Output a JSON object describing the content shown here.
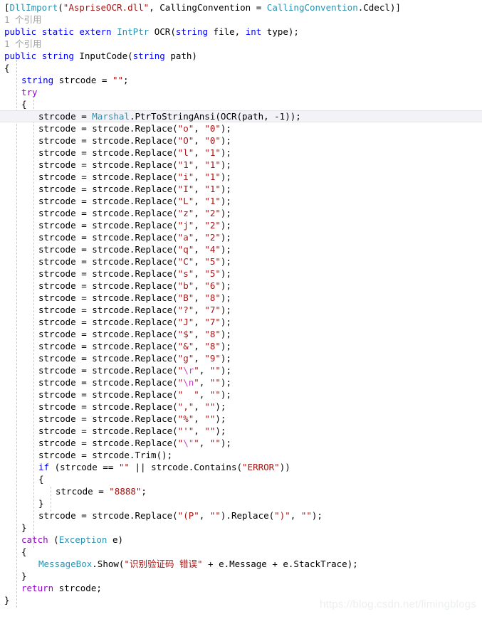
{
  "editor": {
    "language": "csharp",
    "current_line_index": 9,
    "watermark": "https://blog.csdn.net/limingblogs",
    "colors": {
      "background": "#ffffff",
      "keyword": "#0000ff",
      "control_keyword": "#8f08c4",
      "type": "#2b91af",
      "string": "#a31515",
      "escape": "#cc3ec4",
      "plain": "#000000",
      "codelens": "#a0a0a0",
      "current_line_highlight": "#f2f2f7",
      "indent_guide": "#c8c8c8",
      "watermark": "#eceff1"
    },
    "codelens_label": "1 个引用",
    "lines": [
      {
        "indent": 0,
        "tokens": [
          {
            "t": "[",
            "c": "plain"
          },
          {
            "t": "DllImport",
            "c": "type"
          },
          {
            "t": "(",
            "c": "plain"
          },
          {
            "t": "\"AspriseOCR.dll\"",
            "c": "str"
          },
          {
            "t": ", CallingConvention = ",
            "c": "plain"
          },
          {
            "t": "CallingConvention",
            "c": "type"
          },
          {
            "t": ".Cdecl)]",
            "c": "plain"
          }
        ]
      },
      {
        "indent": 0,
        "codelens": true,
        "tokens": [
          {
            "t": "1 个引用",
            "c": "ref"
          }
        ]
      },
      {
        "indent": 0,
        "tokens": [
          {
            "t": "public",
            "c": "kw"
          },
          {
            "t": " ",
            "c": "plain"
          },
          {
            "t": "static",
            "c": "kw"
          },
          {
            "t": " ",
            "c": "plain"
          },
          {
            "t": "extern",
            "c": "kw"
          },
          {
            "t": " ",
            "c": "plain"
          },
          {
            "t": "IntPtr",
            "c": "type"
          },
          {
            "t": " OCR(",
            "c": "plain"
          },
          {
            "t": "string",
            "c": "kw"
          },
          {
            "t": " file, ",
            "c": "plain"
          },
          {
            "t": "int",
            "c": "kw"
          },
          {
            "t": " type);",
            "c": "plain"
          }
        ]
      },
      {
        "indent": 0,
        "codelens": true,
        "tokens": [
          {
            "t": "1 个引用",
            "c": "ref"
          }
        ]
      },
      {
        "indent": 0,
        "tokens": [
          {
            "t": "public",
            "c": "kw"
          },
          {
            "t": " ",
            "c": "plain"
          },
          {
            "t": "string",
            "c": "kw"
          },
          {
            "t": " InputCode(",
            "c": "plain"
          },
          {
            "t": "string",
            "c": "kw"
          },
          {
            "t": " path)",
            "c": "plain"
          }
        ]
      },
      {
        "indent": 0,
        "tokens": [
          {
            "t": "{",
            "c": "plain"
          }
        ]
      },
      {
        "indent": 1,
        "tokens": [
          {
            "t": "string",
            "c": "kw"
          },
          {
            "t": " strcode = ",
            "c": "plain"
          },
          {
            "t": "\"\"",
            "c": "str"
          },
          {
            "t": ";",
            "c": "plain"
          }
        ]
      },
      {
        "indent": 1,
        "tokens": [
          {
            "t": "try",
            "c": "kwc"
          }
        ]
      },
      {
        "indent": 1,
        "tokens": [
          {
            "t": "{",
            "c": "plain"
          }
        ]
      },
      {
        "indent": 2,
        "tokens": [
          {
            "t": "strcode = ",
            "c": "plain"
          },
          {
            "t": "Marshal",
            "c": "type"
          },
          {
            "t": ".PtrToStringAnsi(OCR(path, -1));",
            "c": "plain"
          }
        ]
      },
      {
        "indent": 2,
        "replace": {
          "from": "\"o\"",
          "to": "\"0\""
        }
      },
      {
        "indent": 2,
        "replace": {
          "from": "\"O\"",
          "to": "\"0\""
        }
      },
      {
        "indent": 2,
        "replace": {
          "from": "\"l\"",
          "to": "\"1\""
        }
      },
      {
        "indent": 2,
        "replace": {
          "from": "\"1\"",
          "to": "\"1\""
        }
      },
      {
        "indent": 2,
        "replace": {
          "from": "\"i\"",
          "to": "\"1\""
        }
      },
      {
        "indent": 2,
        "replace": {
          "from": "\"I\"",
          "to": "\"1\""
        }
      },
      {
        "indent": 2,
        "replace": {
          "from": "\"L\"",
          "to": "\"1\""
        }
      },
      {
        "indent": 2,
        "replace": {
          "from": "\"z\"",
          "to": "\"2\""
        }
      },
      {
        "indent": 2,
        "replace": {
          "from": "\"j\"",
          "to": "\"2\""
        }
      },
      {
        "indent": 2,
        "replace": {
          "from": "\"a\"",
          "to": "\"2\""
        }
      },
      {
        "indent": 2,
        "replace": {
          "from": "\"q\"",
          "to": "\"4\""
        }
      },
      {
        "indent": 2,
        "replace": {
          "from": "\"C\"",
          "to": "\"5\""
        }
      },
      {
        "indent": 2,
        "replace": {
          "from": "\"s\"",
          "to": "\"5\""
        }
      },
      {
        "indent": 2,
        "replace": {
          "from": "\"b\"",
          "to": "\"6\""
        }
      },
      {
        "indent": 2,
        "replace": {
          "from": "\"B\"",
          "to": "\"8\""
        }
      },
      {
        "indent": 2,
        "replace": {
          "from": "\"?\"",
          "to": "\"7\""
        }
      },
      {
        "indent": 2,
        "replace": {
          "from": "\"J\"",
          "to": "\"7\""
        }
      },
      {
        "indent": 2,
        "replace": {
          "from": "\"$\"",
          "to": "\"8\""
        }
      },
      {
        "indent": 2,
        "replace": {
          "from": "\"&\"",
          "to": "\"8\""
        }
      },
      {
        "indent": 2,
        "replace": {
          "from": "\"g\"",
          "to": "\"9\""
        }
      },
      {
        "indent": 2,
        "replace": {
          "from": "\"\\r\"",
          "to": "\"\"",
          "escape_from": true
        }
      },
      {
        "indent": 2,
        "replace": {
          "from": "\"\\n\"",
          "to": "\"\"",
          "escape_from": true
        }
      },
      {
        "indent": 2,
        "replace": {
          "from": "\"  \"",
          "to": "\"\""
        }
      },
      {
        "indent": 2,
        "replace": {
          "from": "\",\"",
          "to": "\"\""
        }
      },
      {
        "indent": 2,
        "replace": {
          "from": "\"%\"",
          "to": "\"\""
        }
      },
      {
        "indent": 2,
        "replace": {
          "from": "\"'\"",
          "to": "\"\""
        }
      },
      {
        "indent": 2,
        "replace": {
          "from": "\"\\\"\"",
          "to": "\"\"",
          "escape_from": true
        }
      },
      {
        "indent": 2,
        "tokens": [
          {
            "t": "strcode = strcode.Trim();",
            "c": "plain"
          }
        ]
      },
      {
        "indent": 2,
        "tokens": [
          {
            "t": "if",
            "c": "kw"
          },
          {
            "t": " (strcode == ",
            "c": "plain"
          },
          {
            "t": "\"\"",
            "c": "str"
          },
          {
            "t": " || strcode.Contains(",
            "c": "plain"
          },
          {
            "t": "\"ERROR\"",
            "c": "str"
          },
          {
            "t": "))",
            "c": "plain"
          }
        ]
      },
      {
        "indent": 2,
        "tokens": [
          {
            "t": "{",
            "c": "plain"
          }
        ]
      },
      {
        "indent": 3,
        "tokens": [
          {
            "t": "strcode = ",
            "c": "plain"
          },
          {
            "t": "\"8888\"",
            "c": "str"
          },
          {
            "t": ";",
            "c": "plain"
          }
        ]
      },
      {
        "indent": 2,
        "tokens": [
          {
            "t": "}",
            "c": "plain"
          }
        ]
      },
      {
        "indent": 2,
        "tokens": [
          {
            "t": "strcode = strcode.Replace(",
            "c": "plain"
          },
          {
            "t": "\"(P\"",
            "c": "str"
          },
          {
            "t": ", ",
            "c": "plain"
          },
          {
            "t": "\"\"",
            "c": "str"
          },
          {
            "t": ").Replace(",
            "c": "plain"
          },
          {
            "t": "\")\"",
            "c": "str"
          },
          {
            "t": ", ",
            "c": "plain"
          },
          {
            "t": "\"\"",
            "c": "str"
          },
          {
            "t": ");",
            "c": "plain"
          }
        ]
      },
      {
        "indent": 1,
        "tokens": [
          {
            "t": "}",
            "c": "plain"
          }
        ]
      },
      {
        "indent": 1,
        "tokens": [
          {
            "t": "catch",
            "c": "kwc"
          },
          {
            "t": " (",
            "c": "plain"
          },
          {
            "t": "Exception",
            "c": "type"
          },
          {
            "t": " e)",
            "c": "plain"
          }
        ]
      },
      {
        "indent": 1,
        "tokens": [
          {
            "t": "{",
            "c": "plain"
          }
        ]
      },
      {
        "indent": 2,
        "tokens": [
          {
            "t": "MessageBox",
            "c": "type"
          },
          {
            "t": ".Show(",
            "c": "plain"
          },
          {
            "t": "\"识别验证码 错误\"",
            "c": "str"
          },
          {
            "t": " + e.Message + e.StackTrace);",
            "c": "plain"
          }
        ]
      },
      {
        "indent": 1,
        "tokens": [
          {
            "t": "}",
            "c": "plain"
          }
        ]
      },
      {
        "indent": 1,
        "tokens": [
          {
            "t": "return",
            "c": "kwc"
          },
          {
            "t": " strcode;",
            "c": "plain"
          }
        ]
      },
      {
        "indent": 0,
        "tokens": [
          {
            "t": "}",
            "c": "plain"
          }
        ]
      }
    ]
  }
}
